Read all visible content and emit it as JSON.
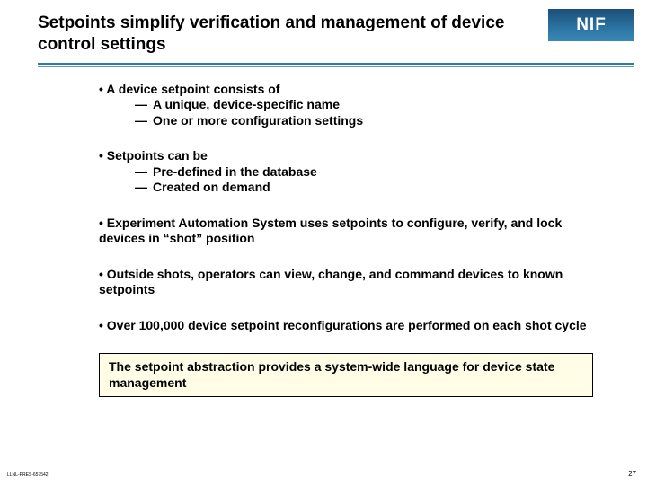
{
  "header": {
    "title": "Setpoints simplify verification and management of device control settings",
    "logo": "NIF"
  },
  "bullets": [
    {
      "lead": "A device setpoint consists of",
      "subs": [
        "A unique, device-specific name",
        "One or more configuration settings"
      ]
    },
    {
      "lead": "Setpoints can be",
      "subs": [
        "Pre-defined in the database",
        "Created on demand"
      ]
    },
    {
      "lead": "Experiment Automation System uses setpoints to configure, verify, and lock devices in “shot” position",
      "subs": []
    },
    {
      "lead": "Outside shots, operators can view, change, and command devices to known setpoints",
      "subs": []
    },
    {
      "lead": "Over 100,000 device setpoint reconfigurations are performed on each shot cycle",
      "subs": []
    }
  ],
  "callout": "The setpoint abstraction provides a system-wide language for device state management",
  "footer": {
    "left": "LLNL-PRES-657542",
    "right": "27"
  }
}
